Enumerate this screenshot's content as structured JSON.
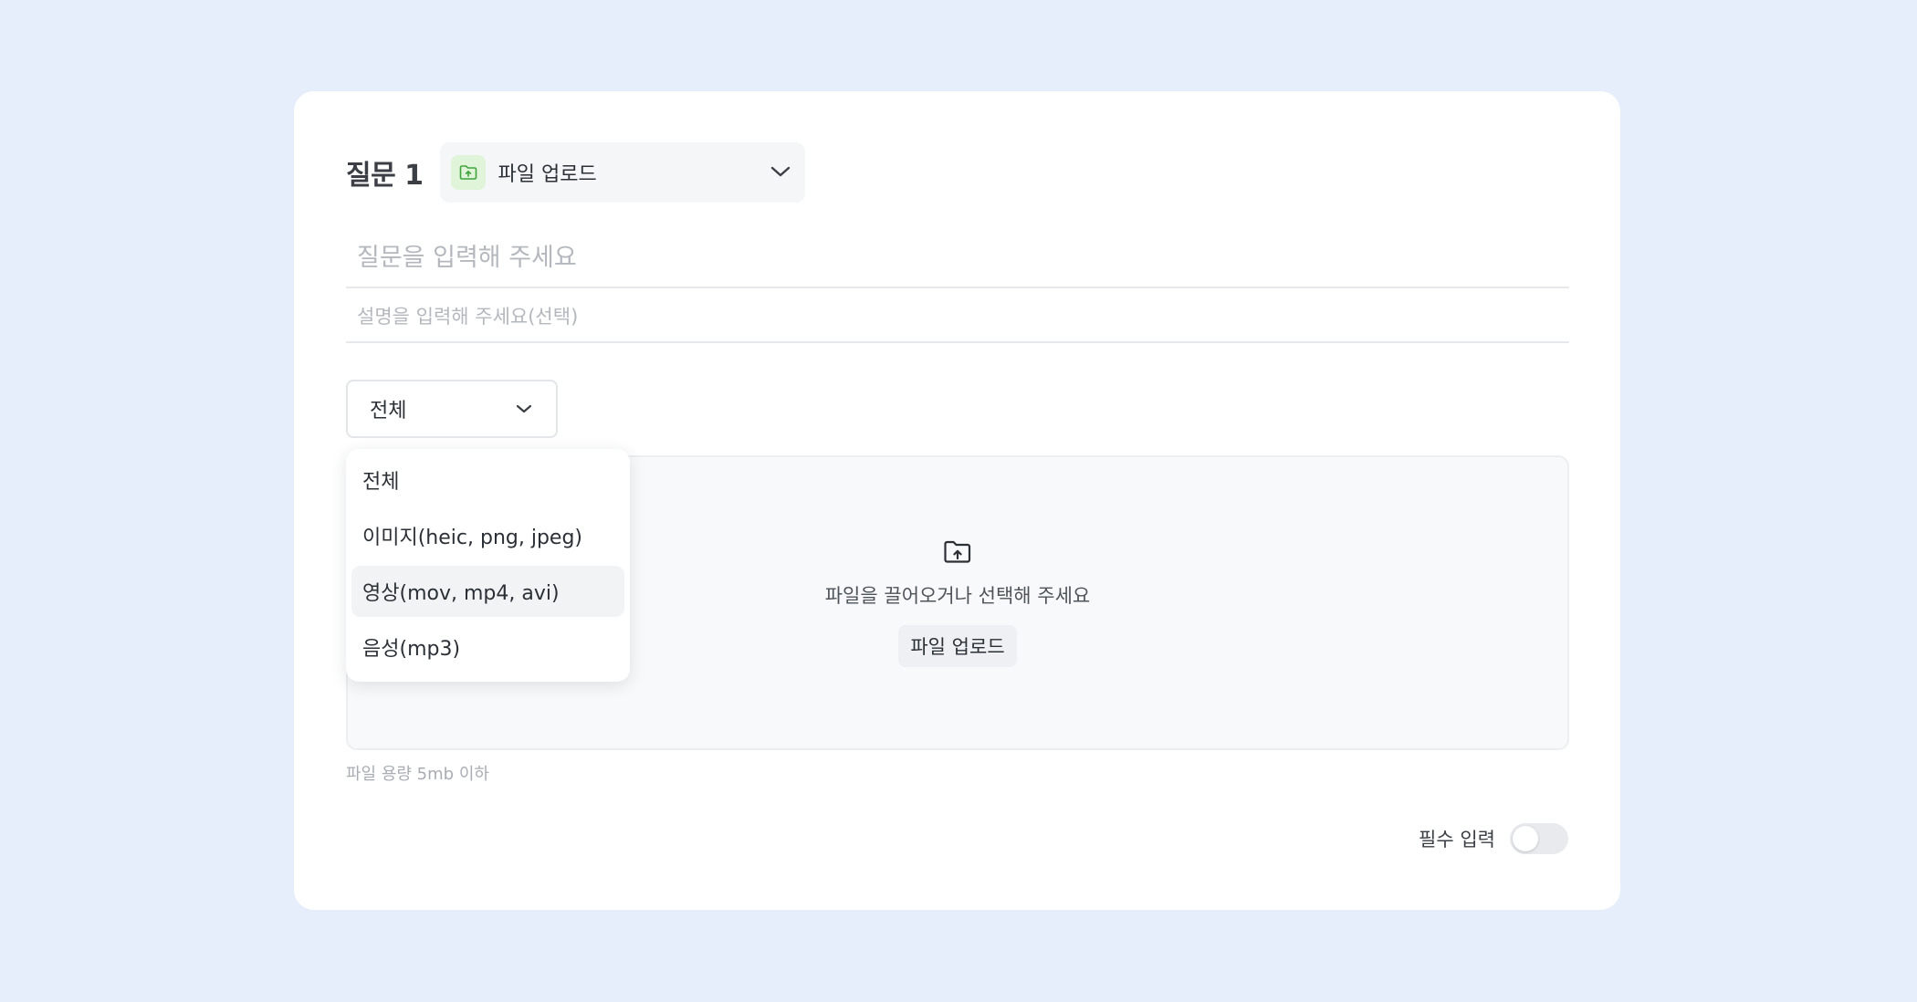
{
  "question": {
    "title": "질문 1",
    "type_label": "파일 업로드",
    "type_icon": "folder-upload-icon",
    "type_icon_color": "#3fa33a",
    "question_placeholder": "질문을 입력해 주세요",
    "description_placeholder": "설명을 입력해 주세요(선택)"
  },
  "filter": {
    "selected": "전체",
    "options": [
      {
        "label": "전체",
        "active": false
      },
      {
        "label": "이미지(heic, png, jpeg)",
        "active": false
      },
      {
        "label": "영상(mov, mp4, avi)",
        "active": true
      },
      {
        "label": "음성(mp3)",
        "active": false
      }
    ]
  },
  "upload": {
    "icon": "folder-upload-icon",
    "prompt": "파일을 끌어오거나 선택해 주세요",
    "button_label": "파일 업로드",
    "size_note": "파일 용량 5mb 이하"
  },
  "required": {
    "label": "필수 입력",
    "enabled": false
  },
  "colors": {
    "page_background": "#e6edfb",
    "card_background": "#ffffff",
    "accent_green": "#3fa33a"
  }
}
